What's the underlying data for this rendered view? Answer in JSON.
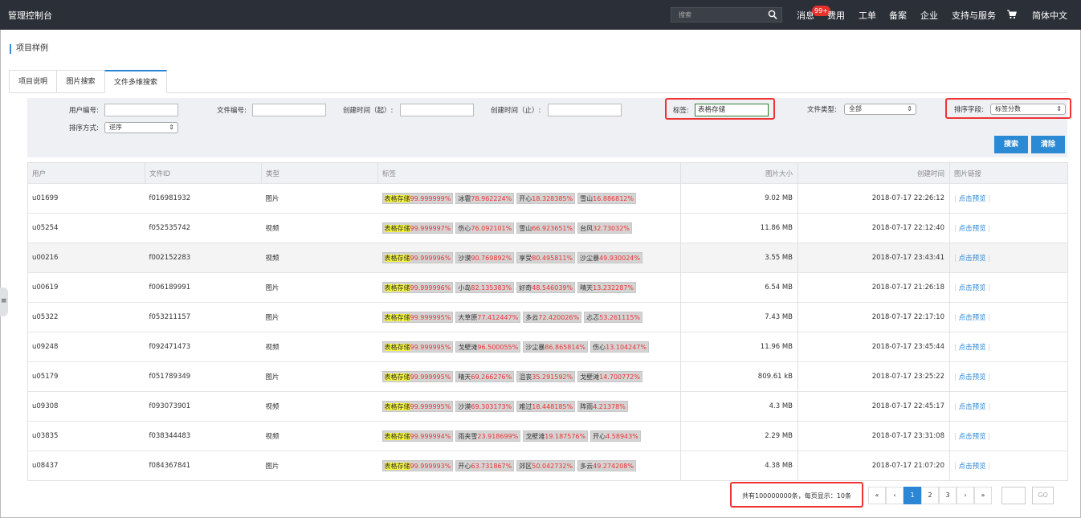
{
  "topbar": {
    "brand": "管理控制台",
    "search_placeholder": "搜索",
    "nav": [
      "消息",
      "费用",
      "工单",
      "备案",
      "企业",
      "支持与服务",
      "简体中文"
    ],
    "badge": "99+"
  },
  "page_title": "项目样例",
  "tabs": [
    "项目说明",
    "图片搜索",
    "文件多维搜索"
  ],
  "filters": {
    "user_id_label": "用户编号:",
    "file_id_label": "文件编号:",
    "start_time_label": "创建时间（起）:",
    "end_time_label": "创建时间（止）:",
    "tag_label": "标签:",
    "tag_value": "表格存储",
    "file_type_label": "文件类型:",
    "file_type_value": "全部",
    "sort_field_label": "排序字段:",
    "sort_field_value": "标签分数",
    "sort_order_label": "排序方式:",
    "sort_order_value": "逆序",
    "search_button": "搜索",
    "clear_button": "清除"
  },
  "table": {
    "headers": [
      "用户",
      "文件ID",
      "类型",
      "标签",
      "图片大小",
      "创建时间",
      "图片链接"
    ],
    "link_text": "点击预览",
    "rows": [
      {
        "user": "u01699",
        "file": "f016981932",
        "type": "图片",
        "tags": [
          [
            "表格存储",
            "99.999999%"
          ],
          [
            "冰雹",
            "78.962224%"
          ],
          [
            "开心",
            "18.328385%"
          ],
          [
            "雪山",
            "16.886812%"
          ]
        ],
        "size": "9.02 MB",
        "time": "2018-07-17 22:26:12"
      },
      {
        "user": "u05254",
        "file": "f052535742",
        "type": "视频",
        "tags": [
          [
            "表格存储",
            "99.999997%"
          ],
          [
            "伤心",
            "76.092101%"
          ],
          [
            "雪山",
            "66.923651%"
          ],
          [
            "台风",
            "32.73032%"
          ]
        ],
        "size": "11.86 MB",
        "time": "2018-07-17 22:12:40"
      },
      {
        "user": "u00216",
        "file": "f002152283",
        "type": "视频",
        "tags": [
          [
            "表格存储",
            "99.999996%"
          ],
          [
            "沙漠",
            "90.769892%"
          ],
          [
            "享受",
            "80.495811%"
          ],
          [
            "沙尘暴",
            "49.930024%"
          ]
        ],
        "size": "3.55 MB",
        "time": "2018-07-17 23:43:41"
      },
      {
        "user": "u00619",
        "file": "f006189991",
        "type": "图片",
        "tags": [
          [
            "表格存储",
            "99.999996%"
          ],
          [
            "小岛",
            "82.135383%"
          ],
          [
            "好奇",
            "48.546039%"
          ],
          [
            "晴天",
            "13.232287%"
          ]
        ],
        "size": "6.54 MB",
        "time": "2018-07-17 21:26:18"
      },
      {
        "user": "u05322",
        "file": "f053211157",
        "type": "图片",
        "tags": [
          [
            "表格存储",
            "99.999995%"
          ],
          [
            "大草原",
            "77.412447%"
          ],
          [
            "多云",
            "72.420026%"
          ],
          [
            "忐忑",
            "53.261115%"
          ]
        ],
        "size": "7.43 MB",
        "time": "2018-07-17 22:17:10"
      },
      {
        "user": "u09248",
        "file": "f092471473",
        "type": "视频",
        "tags": [
          [
            "表格存储",
            "99.999995%"
          ],
          [
            "戈壁滩",
            "96.500055%"
          ],
          [
            "沙尘暴",
            "86.865814%"
          ],
          [
            "伤心",
            "13.104247%"
          ]
        ],
        "size": "11.96 MB",
        "time": "2018-07-17 23:45:44"
      },
      {
        "user": "u05179",
        "file": "f051789349",
        "type": "图片",
        "tags": [
          [
            "表格存储",
            "99.999995%"
          ],
          [
            "晴天",
            "69.266276%"
          ],
          [
            "沮丧",
            "35.291592%"
          ],
          [
            "戈壁滩",
            "14.700772%"
          ]
        ],
        "size": "809.61 kB",
        "time": "2018-07-17 23:25:22"
      },
      {
        "user": "u09308",
        "file": "f093073901",
        "type": "视频",
        "tags": [
          [
            "表格存储",
            "99.999995%"
          ],
          [
            "沙漠",
            "69.303173%"
          ],
          [
            "难过",
            "18.448185%"
          ],
          [
            "阵雨",
            "4.21378%"
          ]
        ],
        "size": "4.3 MB",
        "time": "2018-07-17 22:45:17"
      },
      {
        "user": "u03835",
        "file": "f038344483",
        "type": "视频",
        "tags": [
          [
            "表格存储",
            "99.999994%"
          ],
          [
            "雨夹雪",
            "23.918699%"
          ],
          [
            "戈壁滩",
            "19.187576%"
          ],
          [
            "开心",
            "4.58943%"
          ]
        ],
        "size": "2.29 MB",
        "time": "2018-07-17 23:31:08"
      },
      {
        "user": "u08437",
        "file": "f084367841",
        "type": "图片",
        "tags": [
          [
            "表格存储",
            "99.999993%"
          ],
          [
            "开心",
            "63.731867%"
          ],
          [
            "郊区",
            "50.042732%"
          ],
          [
            "多云",
            "49.274208%"
          ]
        ],
        "size": "4.38 MB",
        "time": "2018-07-17 21:07:20"
      }
    ]
  },
  "pagination": {
    "total_text": "共有100000000条，每页显示：10条",
    "buttons": [
      "«",
      "‹",
      "1",
      "2",
      "3",
      "›",
      "»"
    ],
    "current": "1",
    "go": "GO"
  }
}
